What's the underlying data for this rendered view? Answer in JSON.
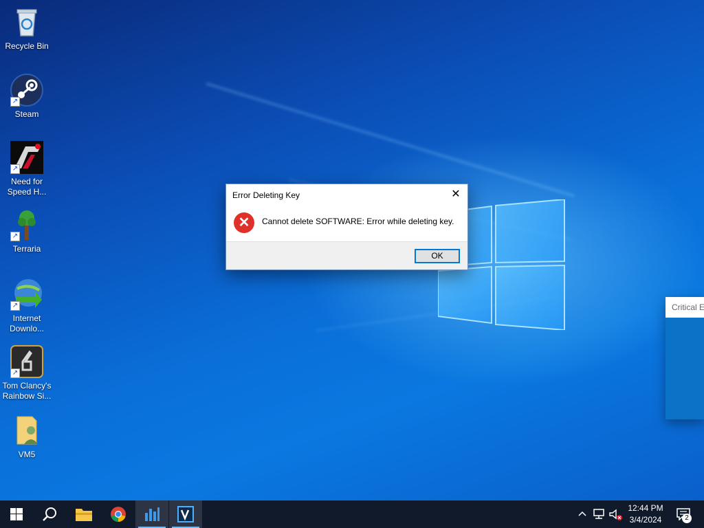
{
  "desktop_icons": [
    {
      "label": "Recycle Bin",
      "icon": "recycle-bin-icon"
    },
    {
      "label": "Steam",
      "icon": "steam-icon"
    },
    {
      "label": "Need for Speed H...",
      "icon": "need-for-speed-icon"
    },
    {
      "label": "Terraria",
      "icon": "terraria-icon"
    },
    {
      "label": "Internet Downlo...",
      "icon": "internet-download-manager-icon"
    },
    {
      "label": "Tom Clancy's Rainbow Si...",
      "icon": "rainbow-six-icon"
    },
    {
      "label": "VM5",
      "icon": "user-folder-icon"
    }
  ],
  "dialog": {
    "title": "Error Deleting Key",
    "message": "Cannot delete SOFTWARE:  Error while deleting key.",
    "ok_label": "OK",
    "close_glyph": "✕",
    "icon": "error-icon"
  },
  "background_window": {
    "title": "Critical E"
  },
  "taskbar": {
    "apps": [
      {
        "name": "start",
        "icon": "windows-start-icon"
      },
      {
        "name": "search",
        "icon": "search-icon"
      },
      {
        "name": "file-explorer",
        "icon": "folder-icon"
      },
      {
        "name": "chrome",
        "icon": "chrome-icon"
      },
      {
        "name": "regedit",
        "icon": "registry-editor-icon"
      },
      {
        "name": "virtualbox-app",
        "icon": "v-app-icon"
      }
    ],
    "time": "12:44 PM",
    "date": "3/4/2024",
    "notification_count": "2"
  },
  "colors": {
    "accent": "#0078d7",
    "error_red": "#e0302a",
    "taskbar": "#101a2b"
  }
}
